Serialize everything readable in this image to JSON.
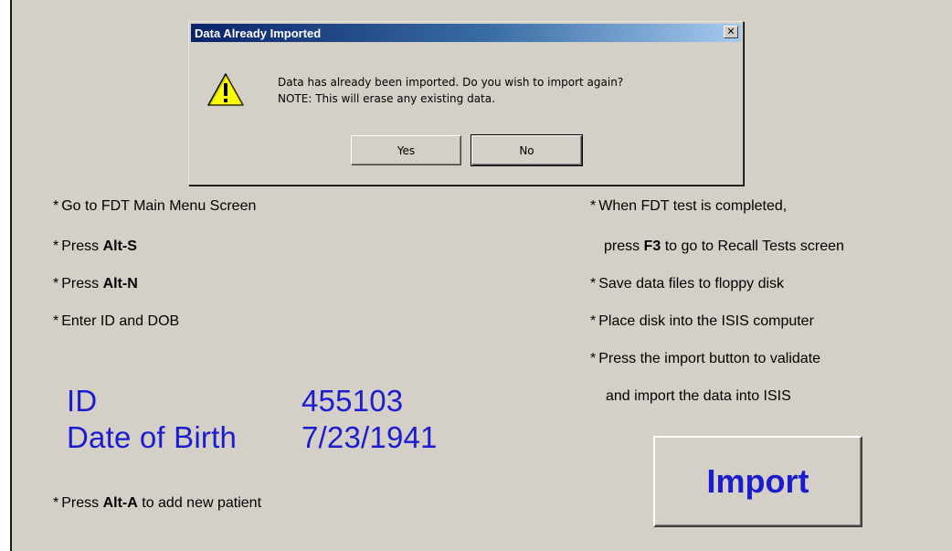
{
  "instructions_left": [
    {
      "pre": "Go to FDT Main Menu Screen",
      "key": "",
      "post": ""
    },
    {
      "pre": "Press ",
      "key": "Alt-S",
      "post": ""
    },
    {
      "pre": "Press ",
      "key": "Alt-N",
      "post": ""
    },
    {
      "pre": "Enter ID and DOB",
      "key": "",
      "post": ""
    }
  ],
  "instructions_right": {
    "line1": "When FDT test is completed,",
    "line2_pre": "press ",
    "line2_key": "F3",
    "line2_post": " to go to Recall Tests screen",
    "line3": "Save data files to floppy disk",
    "line4": "Place disk into the ISIS computer",
    "line5": "Press the import button to validate",
    "line6": "and import the data into ISIS"
  },
  "patient": {
    "id_label": "ID",
    "id_value": "455103",
    "dob_label": "Date of Birth",
    "dob_value": "7/23/1941"
  },
  "add_patient": {
    "pre": "Press ",
    "key": "Alt-A",
    "post": " to add new patient"
  },
  "import_button": "Import",
  "dialog": {
    "title": "Data Already Imported",
    "close": "✕",
    "message_line1": "Data has already been imported. Do you wish to import again?",
    "message_line2": "NOTE: This will erase any existing data.",
    "yes": "Yes",
    "no": "No",
    "icon": "warning-icon"
  },
  "bullet": "*",
  "colors": {
    "background": "#d4d0c8",
    "accent_blue": "#1c1ccf",
    "titlebar_start": "#0a246a",
    "titlebar_end": "#a6caf0",
    "warning_yellow": "#ffff00"
  }
}
